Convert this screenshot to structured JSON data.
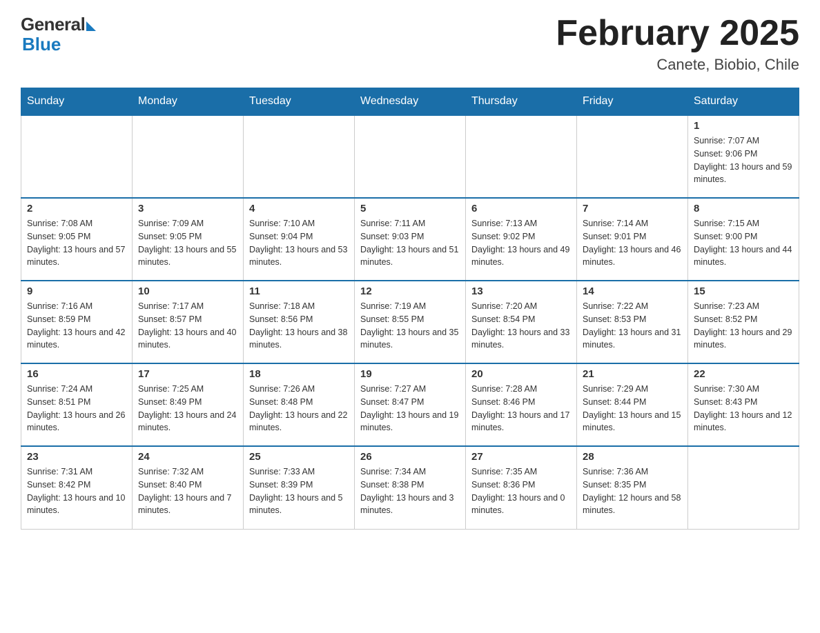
{
  "header": {
    "logo_general": "General",
    "logo_blue": "Blue",
    "month_title": "February 2025",
    "location": "Canete, Biobio, Chile"
  },
  "weekdays": [
    "Sunday",
    "Monday",
    "Tuesday",
    "Wednesday",
    "Thursday",
    "Friday",
    "Saturday"
  ],
  "weeks": [
    [
      {
        "day": "",
        "sunrise": "",
        "sunset": "",
        "daylight": "",
        "empty": true
      },
      {
        "day": "",
        "sunrise": "",
        "sunset": "",
        "daylight": "",
        "empty": true
      },
      {
        "day": "",
        "sunrise": "",
        "sunset": "",
        "daylight": "",
        "empty": true
      },
      {
        "day": "",
        "sunrise": "",
        "sunset": "",
        "daylight": "",
        "empty": true
      },
      {
        "day": "",
        "sunrise": "",
        "sunset": "",
        "daylight": "",
        "empty": true
      },
      {
        "day": "",
        "sunrise": "",
        "sunset": "",
        "daylight": "",
        "empty": true
      },
      {
        "day": "1",
        "sunrise": "Sunrise: 7:07 AM",
        "sunset": "Sunset: 9:06 PM",
        "daylight": "Daylight: 13 hours and 59 minutes.",
        "empty": false
      }
    ],
    [
      {
        "day": "2",
        "sunrise": "Sunrise: 7:08 AM",
        "sunset": "Sunset: 9:05 PM",
        "daylight": "Daylight: 13 hours and 57 minutes.",
        "empty": false
      },
      {
        "day": "3",
        "sunrise": "Sunrise: 7:09 AM",
        "sunset": "Sunset: 9:05 PM",
        "daylight": "Daylight: 13 hours and 55 minutes.",
        "empty": false
      },
      {
        "day": "4",
        "sunrise": "Sunrise: 7:10 AM",
        "sunset": "Sunset: 9:04 PM",
        "daylight": "Daylight: 13 hours and 53 minutes.",
        "empty": false
      },
      {
        "day": "5",
        "sunrise": "Sunrise: 7:11 AM",
        "sunset": "Sunset: 9:03 PM",
        "daylight": "Daylight: 13 hours and 51 minutes.",
        "empty": false
      },
      {
        "day": "6",
        "sunrise": "Sunrise: 7:13 AM",
        "sunset": "Sunset: 9:02 PM",
        "daylight": "Daylight: 13 hours and 49 minutes.",
        "empty": false
      },
      {
        "day": "7",
        "sunrise": "Sunrise: 7:14 AM",
        "sunset": "Sunset: 9:01 PM",
        "daylight": "Daylight: 13 hours and 46 minutes.",
        "empty": false
      },
      {
        "day": "8",
        "sunrise": "Sunrise: 7:15 AM",
        "sunset": "Sunset: 9:00 PM",
        "daylight": "Daylight: 13 hours and 44 minutes.",
        "empty": false
      }
    ],
    [
      {
        "day": "9",
        "sunrise": "Sunrise: 7:16 AM",
        "sunset": "Sunset: 8:59 PM",
        "daylight": "Daylight: 13 hours and 42 minutes.",
        "empty": false
      },
      {
        "day": "10",
        "sunrise": "Sunrise: 7:17 AM",
        "sunset": "Sunset: 8:57 PM",
        "daylight": "Daylight: 13 hours and 40 minutes.",
        "empty": false
      },
      {
        "day": "11",
        "sunrise": "Sunrise: 7:18 AM",
        "sunset": "Sunset: 8:56 PM",
        "daylight": "Daylight: 13 hours and 38 minutes.",
        "empty": false
      },
      {
        "day": "12",
        "sunrise": "Sunrise: 7:19 AM",
        "sunset": "Sunset: 8:55 PM",
        "daylight": "Daylight: 13 hours and 35 minutes.",
        "empty": false
      },
      {
        "day": "13",
        "sunrise": "Sunrise: 7:20 AM",
        "sunset": "Sunset: 8:54 PM",
        "daylight": "Daylight: 13 hours and 33 minutes.",
        "empty": false
      },
      {
        "day": "14",
        "sunrise": "Sunrise: 7:22 AM",
        "sunset": "Sunset: 8:53 PM",
        "daylight": "Daylight: 13 hours and 31 minutes.",
        "empty": false
      },
      {
        "day": "15",
        "sunrise": "Sunrise: 7:23 AM",
        "sunset": "Sunset: 8:52 PM",
        "daylight": "Daylight: 13 hours and 29 minutes.",
        "empty": false
      }
    ],
    [
      {
        "day": "16",
        "sunrise": "Sunrise: 7:24 AM",
        "sunset": "Sunset: 8:51 PM",
        "daylight": "Daylight: 13 hours and 26 minutes.",
        "empty": false
      },
      {
        "day": "17",
        "sunrise": "Sunrise: 7:25 AM",
        "sunset": "Sunset: 8:49 PM",
        "daylight": "Daylight: 13 hours and 24 minutes.",
        "empty": false
      },
      {
        "day": "18",
        "sunrise": "Sunrise: 7:26 AM",
        "sunset": "Sunset: 8:48 PM",
        "daylight": "Daylight: 13 hours and 22 minutes.",
        "empty": false
      },
      {
        "day": "19",
        "sunrise": "Sunrise: 7:27 AM",
        "sunset": "Sunset: 8:47 PM",
        "daylight": "Daylight: 13 hours and 19 minutes.",
        "empty": false
      },
      {
        "day": "20",
        "sunrise": "Sunrise: 7:28 AM",
        "sunset": "Sunset: 8:46 PM",
        "daylight": "Daylight: 13 hours and 17 minutes.",
        "empty": false
      },
      {
        "day": "21",
        "sunrise": "Sunrise: 7:29 AM",
        "sunset": "Sunset: 8:44 PM",
        "daylight": "Daylight: 13 hours and 15 minutes.",
        "empty": false
      },
      {
        "day": "22",
        "sunrise": "Sunrise: 7:30 AM",
        "sunset": "Sunset: 8:43 PM",
        "daylight": "Daylight: 13 hours and 12 minutes.",
        "empty": false
      }
    ],
    [
      {
        "day": "23",
        "sunrise": "Sunrise: 7:31 AM",
        "sunset": "Sunset: 8:42 PM",
        "daylight": "Daylight: 13 hours and 10 minutes.",
        "empty": false
      },
      {
        "day": "24",
        "sunrise": "Sunrise: 7:32 AM",
        "sunset": "Sunset: 8:40 PM",
        "daylight": "Daylight: 13 hours and 7 minutes.",
        "empty": false
      },
      {
        "day": "25",
        "sunrise": "Sunrise: 7:33 AM",
        "sunset": "Sunset: 8:39 PM",
        "daylight": "Daylight: 13 hours and 5 minutes.",
        "empty": false
      },
      {
        "day": "26",
        "sunrise": "Sunrise: 7:34 AM",
        "sunset": "Sunset: 8:38 PM",
        "daylight": "Daylight: 13 hours and 3 minutes.",
        "empty": false
      },
      {
        "day": "27",
        "sunrise": "Sunrise: 7:35 AM",
        "sunset": "Sunset: 8:36 PM",
        "daylight": "Daylight: 13 hours and 0 minutes.",
        "empty": false
      },
      {
        "day": "28",
        "sunrise": "Sunrise: 7:36 AM",
        "sunset": "Sunset: 8:35 PM",
        "daylight": "Daylight: 12 hours and 58 minutes.",
        "empty": false
      },
      {
        "day": "",
        "sunrise": "",
        "sunset": "",
        "daylight": "",
        "empty": true
      }
    ]
  ]
}
